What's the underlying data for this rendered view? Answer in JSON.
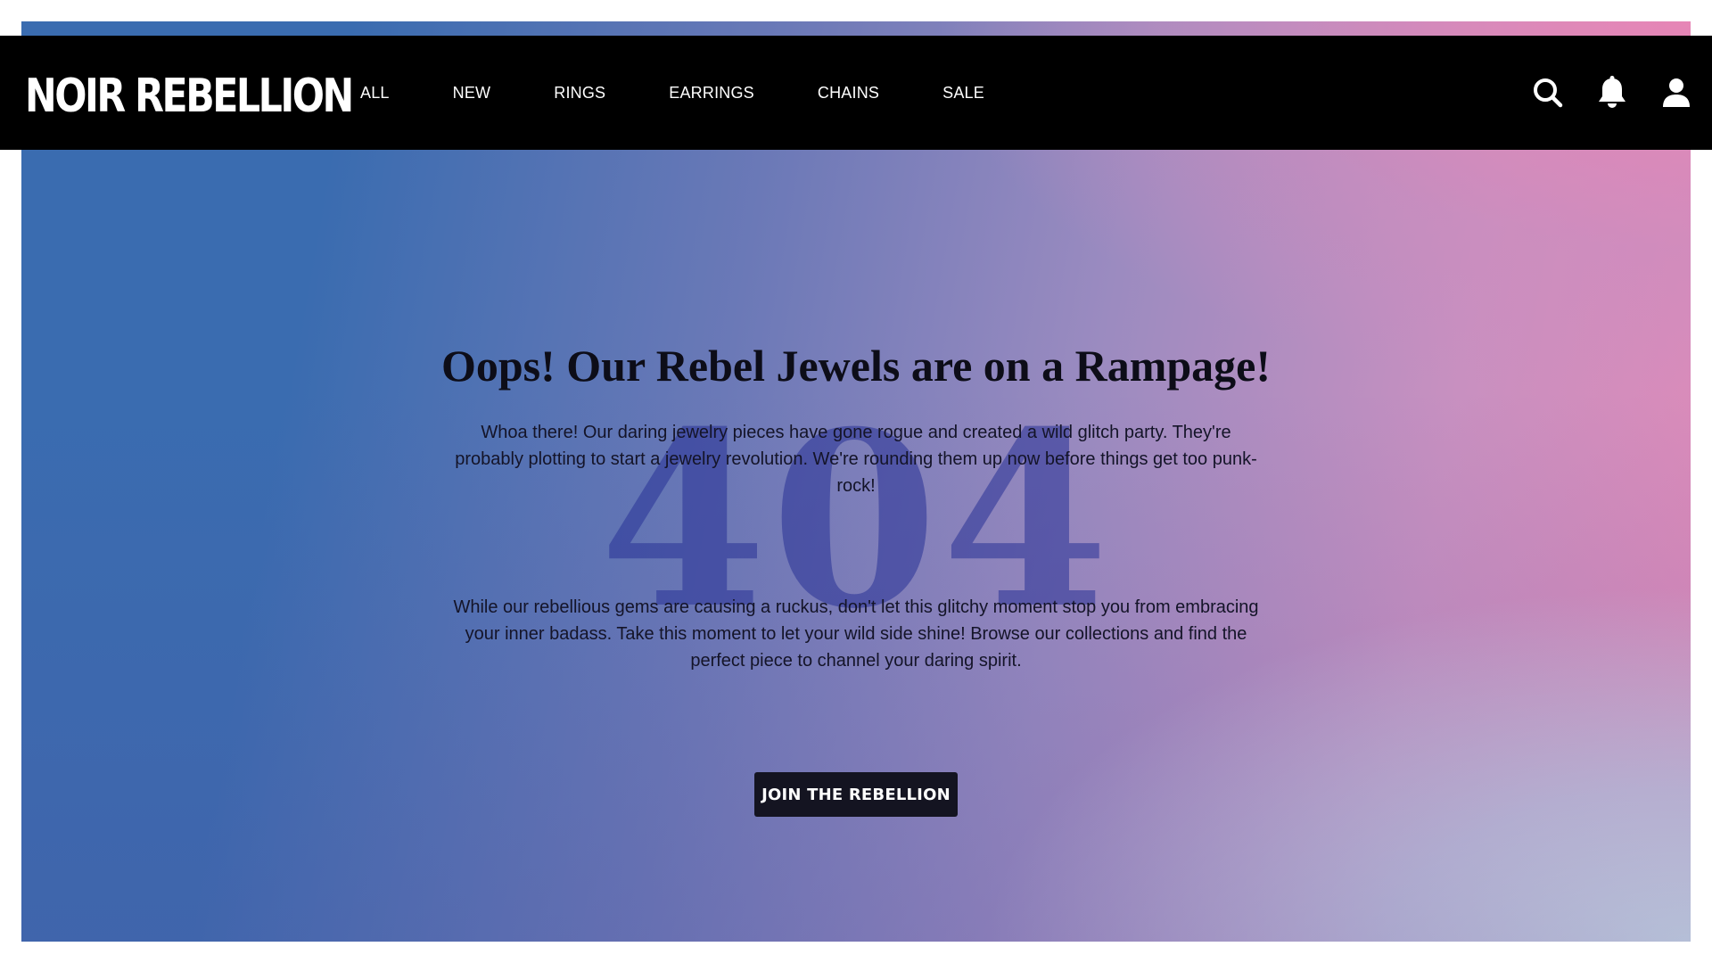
{
  "brand": {
    "name": "NOIR REBELLION"
  },
  "nav": {
    "items": [
      {
        "label": "ALL"
      },
      {
        "label": "NEW"
      },
      {
        "label": "RINGS"
      },
      {
        "label": "EARRINGS"
      },
      {
        "label": "CHAINS"
      },
      {
        "label": "SALE"
      }
    ]
  },
  "header_icons": {
    "search": "search-icon",
    "notifications": "bell-icon",
    "account": "user-icon"
  },
  "error": {
    "code": "404",
    "title": "Oops! Our Rebel Jewels are on a Rampage!",
    "paragraph1": "Whoa there! Our daring jewelry pieces have gone rogue and created a wild glitch party. They're probably plotting to start a jewelry revolution. We're rounding them up now before things get too punk-rock!",
    "paragraph2": "While our rebellious gems are causing a ruckus, don't let this glitchy moment stop you from embracing your inner badass. Take this moment to let your wild side shine! Browse our collections and find the perfect piece to channel your daring spirit.",
    "cta_label": "JOIN THE REBELLION"
  },
  "colors": {
    "header_bg": "#000000",
    "gradient_start": "#3a6cb0",
    "gradient_end": "#e08ab8",
    "gradient_corner": "#d6e8ec",
    "button_bg": "#141421",
    "watermark": "#28329b"
  }
}
